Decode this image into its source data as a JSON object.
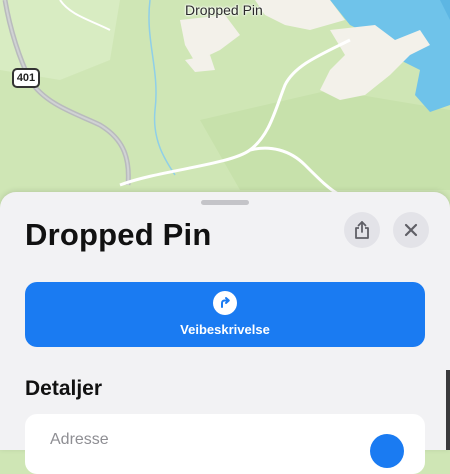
{
  "map": {
    "pin_label": "Dropped Pin",
    "road_shield": "401",
    "colors": {
      "land": "#cfe6b5",
      "water": "#6fc3ea",
      "built": "#f3f1ea",
      "road": "#ffffff",
      "highway": "#b9bbbd"
    }
  },
  "sheet": {
    "title": "Dropped Pin",
    "share_icon": "share-icon",
    "close_icon": "close-icon",
    "directions": {
      "label": "Veibeskrivelse",
      "icon": "directions-arrow-icon",
      "color": "#1a7bf2"
    },
    "details": {
      "heading": "Detaljer",
      "address_label": "Adresse"
    }
  }
}
